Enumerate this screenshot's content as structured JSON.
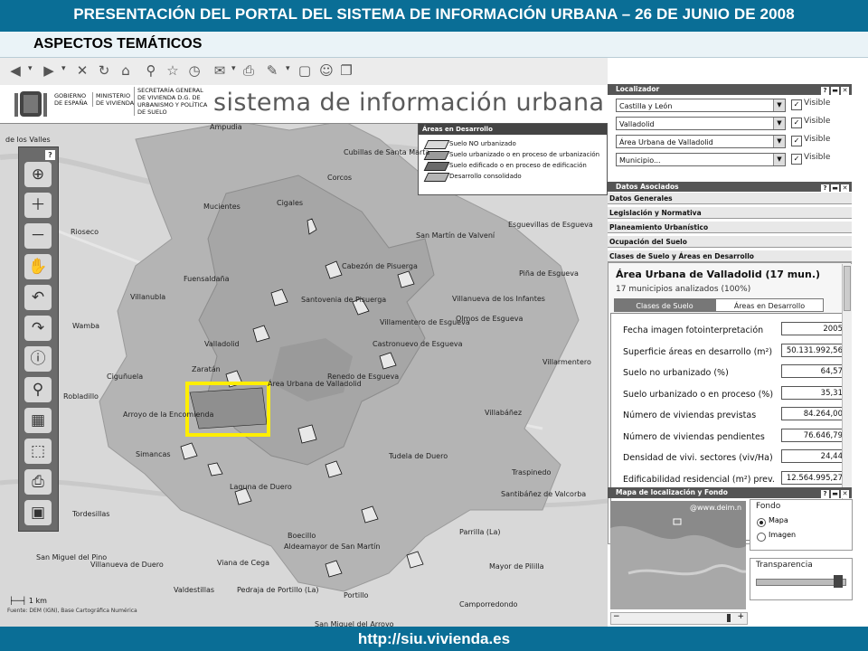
{
  "header": {
    "title": "PRESENTACIÓN DEL PORTAL DEL SISTEMA DE INFORMACIÓN URBANA – 26 DE JUNIO DE 2008",
    "subtitle": "ASPECTOS TEMÁTICOS"
  },
  "footer": {
    "url": "http://siu.vivienda.es"
  },
  "banner": {
    "gov_line1": "GOBIERNO DE ESPAÑA",
    "gov_line2": "MINISTERIO DE VIVIENDA",
    "gov_line3": "SECRETARÍA GENERAL DE VIVIENDA D.G. DE URBANISMO Y POLÍTICA DE SUELO",
    "site_title": "sistema de información urbana"
  },
  "legend": {
    "title": "Áreas en Desarrollo",
    "items": [
      {
        "label": "Suelo NO urbanizado",
        "color": "#d9d9d9"
      },
      {
        "label": "Suelo urbanizado o en proceso de urbanización",
        "color": "#9a9a9a"
      },
      {
        "label": "Suelo edificado o en proceso de edificación",
        "color": "#6a6a6a"
      },
      {
        "label": "Desarrollo consolidado",
        "color": "#b5b5b5"
      }
    ]
  },
  "map": {
    "labels": [
      "de los Valles",
      "Ampudia",
      "Cubillas de Santa Marta",
      "Corcos",
      "Mucientes",
      "Cigales",
      "San Martín de Valvení",
      "Esguevillas de Esgueva",
      "Fuensaldaña",
      "Cabezón de Pisuerga",
      "Piña de Esgueva",
      "Villanubla",
      "Santovenia de Pisuerga",
      "Villanueva de los Infantes",
      "Wamba",
      "Villamentero de Esgueva",
      "Olmos de Esgueva",
      "Valladolid",
      "Castronuevo de Esgueva",
      "Zaratán",
      "Renedo de Esgueva",
      "Villarmentero",
      "Ciguñuela",
      "Área Urbana de Valladolid",
      "Villabáñez",
      "Arroyo de la Encomienda",
      "Robladillo",
      "Simancas",
      "Tudela de Duero",
      "Traspinedo",
      "Laguna de Duero",
      "Santibáñez de Valcorba",
      "Tordesillas",
      "Boecillo",
      "Aldeamayor de San Martín",
      "Parrilla (La)",
      "San Miguel del Pino",
      "Viana de Cega",
      "Mayor de Pililla",
      "Villanueva de Duero",
      "Valdestillas",
      "Pedraja de Portillo (La)",
      "Portillo",
      "Camporredondo",
      "San Miguel del Arroyo",
      "Rioseco"
    ],
    "scale": "1 km",
    "source": "Fuente: DEM (IGN), Base Cartográfica Numérica"
  },
  "localizador": {
    "title": "Localizador",
    "rows": [
      {
        "value": "Castilla y León",
        "check": "Visible"
      },
      {
        "value": "Valladolid",
        "check": "Visible"
      },
      {
        "value": "Área Urbana de Valladolid",
        "check": "Visible"
      },
      {
        "value": "Municipio...",
        "check": "Visible"
      }
    ]
  },
  "datos": {
    "title": "Datos Asociados",
    "sections": [
      "Datos Generales",
      "Legislación y Normativa",
      "Planeamiento Urbanístico",
      "Ocupación del Suelo",
      "Clases de Suelo y Áreas en Desarrollo"
    ]
  },
  "area": {
    "title": "Área Urbana de Valladolid (17 mun.)",
    "subtitle": "17 municipios analizados (100%)",
    "tabs": [
      "Clases de Suelo",
      "Áreas en Desarrollo"
    ],
    "stats": [
      {
        "label": "Fecha imagen fotointerpretación",
        "value": "2005"
      },
      {
        "label": "Superficie áreas en desarrollo (m²)",
        "value": "50.131.992,56"
      },
      {
        "label": "Suelo no urbanizado (%)",
        "value": "64,57"
      },
      {
        "label": "Suelo urbanizado o en proceso (%)",
        "value": "35,31"
      },
      {
        "label": "Número de viviendas previstas",
        "value": "84.264,00"
      },
      {
        "label": "Número de viviendas pendientes",
        "value": "76.646,79"
      },
      {
        "label": "Densidad de vivi. sectores (viv/Ha)",
        "value": "24,44"
      },
      {
        "label": "Edificabilidad residencial (m²) prev.",
        "value": "12.564.995,27"
      }
    ]
  },
  "mapa_fondo": {
    "title": "Mapa de localización y Fondo",
    "fondo": "Fondo",
    "options": [
      "Mapa",
      "Imagen"
    ],
    "transparencia": "Transparencia",
    "watermark": "@www.deim.n"
  }
}
